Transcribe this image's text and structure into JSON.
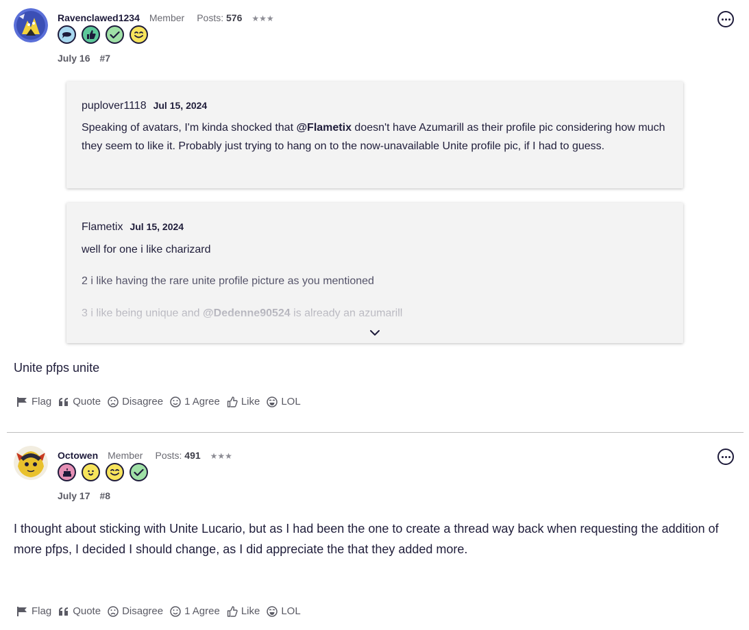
{
  "posts": [
    {
      "username": "Ravenclawed1234",
      "role": "Member",
      "posts_label": "Posts:",
      "posts_count": "576",
      "stars": "★★★",
      "date": "July 16",
      "post_number": "#7",
      "badges": [
        "speech-bubble-icon",
        "thumbs-up-icon",
        "checkmark-icon",
        "wink-face-icon"
      ],
      "quotes": [
        {
          "author": "puplover1118",
          "date": "Jul 15, 2024",
          "text_before": "Speaking of avatars, I'm kinda shocked that ",
          "mention": "@Flametix",
          "text_after": " doesn't have Azumarill as their profile pic considering how much they seem to like it. Probably just trying to hang on to the now-unavailable Unite profile pic, if I had to guess."
        },
        {
          "author": "Flametix",
          "date": "Jul 15, 2024",
          "line1": "well for one i like charizard",
          "line2": "2 i like having the rare unite profile picture as you mentioned",
          "line3_before": "3 i like being unique and ",
          "line3_mention": "@Dedenne90524",
          "line3_after": " is already an azumarill"
        }
      ],
      "body": "Unite pfps unite",
      "actions": {
        "flag": "Flag",
        "quote": "Quote",
        "disagree": "Disagree",
        "agree": "1 Agree",
        "like": "Like",
        "lol": "LOL"
      }
    },
    {
      "username": "Octowen",
      "role": "Member",
      "posts_label": "Posts:",
      "posts_count": "491",
      "stars": "★★★",
      "date": "July 17",
      "post_number": "#8",
      "badges": [
        "birthday-cake-icon",
        "surprised-face-icon",
        "wink-face-icon",
        "checkmark-icon"
      ],
      "body": "I thought about sticking with Unite Lucario, but as I had been the one to create a thread way back when requesting the addition of more pfps, I decided I should change, as I did appreciate the that they added more.",
      "actions": {
        "flag": "Flag",
        "quote": "Quote",
        "disagree": "Disagree",
        "agree": "1 Agree",
        "like": "Like",
        "lol": "LOL"
      }
    }
  ],
  "colors": {
    "text": "#1f1d3a",
    "muted": "#5a5a64",
    "quote_bg": "#f3f3f3",
    "badge_blue": "#a8d8f0",
    "badge_green": "#5cc89a",
    "badge_lightgreen": "#9fe0a6",
    "badge_yellow": "#f7e45c",
    "badge_pink": "#e58fb5"
  }
}
